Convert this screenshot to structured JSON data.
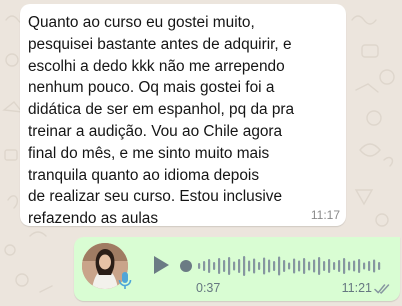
{
  "incoming_message": {
    "text": "Quanto ao curso eu gostei muito,\npesquisei bastante antes de adquirir, e\nescolhi a dedo kkk não me arrependo\nnenhum pouco. Oq mais gostei foi a\ndidática de ser em espanhol, pq da pra\ntreinar a audição. Vou ao Chile agora\nfinal do mês, e me sinto muito mais\ntranquila quanto ao idioma depois\nde realizar seu curso. Estou inclusive\nrefazendo as aulas",
    "time": "11:17"
  },
  "voice_message": {
    "duration": "0:37",
    "time": "11:21",
    "progress": 0,
    "status_icon": "double-check-icon"
  },
  "colors": {
    "wallpaper": "#ece5dd",
    "incoming_bubble": "#ffffff",
    "outgoing_bubble": "#d9fdd3",
    "waveform": "#8696a0",
    "meta_text": "#667781"
  }
}
